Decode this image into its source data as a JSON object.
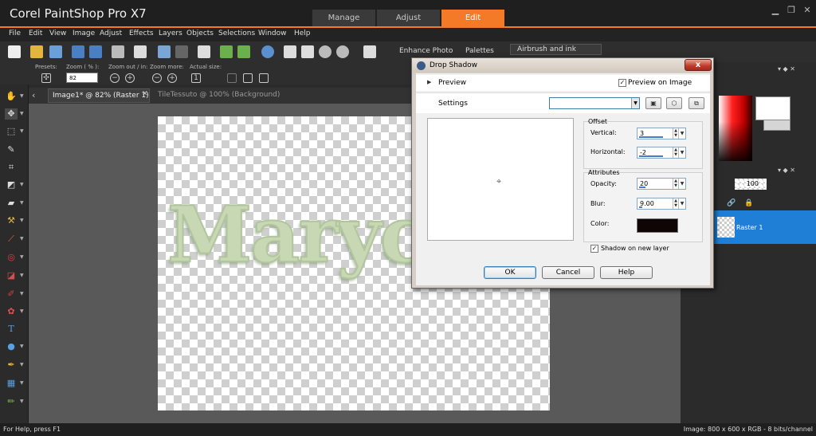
{
  "app": {
    "title": "Corel PaintShop Pro X7",
    "workspace_tabs": [
      {
        "label": "Manage",
        "active": false
      },
      {
        "label": "Adjust",
        "active": false
      },
      {
        "label": "Edit",
        "active": true
      }
    ],
    "accent_color": "#f57a28"
  },
  "menu": [
    "File",
    "Edit",
    "View",
    "Image",
    "Adjust",
    "Effects",
    "Layers",
    "Objects",
    "Selections",
    "Window",
    "Help"
  ],
  "toolbar": {
    "enhance_photo": "Enhance Photo",
    "palettes": "Palettes",
    "brush_preset": "Airbrush and ink"
  },
  "tool_options": {
    "presets_label": "Presets:",
    "zoom_label": "Zoom ( % ):",
    "zoom_value": "82",
    "zoom_out_in_label": "Zoom out / in:",
    "zoom_more_label": "Zoom more:",
    "actual_size_label": "Actual size:"
  },
  "doc_tabs": [
    {
      "label": "Image1* @  82% (Raster 1)",
      "active": true
    },
    {
      "label": "TileTessuto @ 100% (Background)",
      "active": false
    }
  ],
  "canvas": {
    "text": "Maryc"
  },
  "layers": {
    "opacity": "100",
    "layer_name": "Raster 1"
  },
  "status": {
    "help": "For Help, press F1",
    "image_info": "Image:  800 x 600 x RGB - 8 bits/channel"
  },
  "dialog": {
    "title": "Drop Shadow",
    "close": "x",
    "preview_label": "Preview",
    "preview_on_image_label": "Preview on Image",
    "preview_on_image_checked": true,
    "settings_label": "Settings",
    "settings_value": "",
    "offset_title": "Offset",
    "vertical_label": "Vertical:",
    "vertical_value": "3",
    "horizontal_label": "Horizontal:",
    "horizontal_value": "-2",
    "attributes_title": "Attributes",
    "opacity_label": "Opacity:",
    "opacity_value": "20",
    "blur_label": "Blur:",
    "blur_value": "9.00",
    "color_label": "Color:",
    "shadow_color": "#0f0505",
    "shadow_new_layer_label": "Shadow on new layer",
    "shadow_new_layer_checked": true,
    "ok": "OK",
    "cancel": "Cancel",
    "help": "Help"
  }
}
